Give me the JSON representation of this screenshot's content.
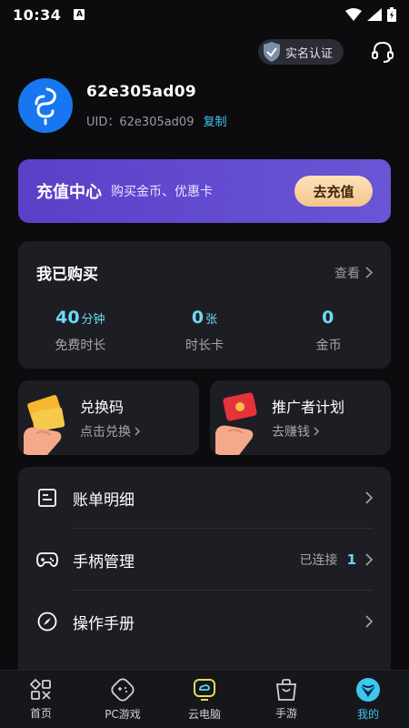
{
  "status_bar": {
    "time": "10:34",
    "notif_letter": "A"
  },
  "top": {
    "realname_label": "实名认证"
  },
  "profile": {
    "username": "62e305ad09",
    "uid_label": "UID：62e305ad09",
    "copy_label": "复制"
  },
  "recharge": {
    "title": "充值中心",
    "subtitle": "购买金币、优惠卡",
    "button_label": "去充值"
  },
  "purchased": {
    "title": "我已购买",
    "view_label": "查看",
    "stats": [
      {
        "value": "40",
        "unit": "分钟",
        "label": "免费时长"
      },
      {
        "value": "0",
        "unit": "张",
        "label": "时长卡"
      },
      {
        "value": "0",
        "unit": "",
        "label": "金币"
      }
    ]
  },
  "cards": [
    {
      "title": "兑换码",
      "subtitle": "点击兑换",
      "icon": "coupon-hand-icon"
    },
    {
      "title": "推广者计划",
      "subtitle": "去赚钱",
      "icon": "redpacket-hand-icon"
    }
  ],
  "menu": [
    {
      "label": "账单明细",
      "right_text": "",
      "count": "",
      "icon": "bill-icon"
    },
    {
      "label": "手柄管理",
      "right_text": "已连接",
      "count": "1",
      "icon": "gamepad-icon"
    },
    {
      "label": "操作手册",
      "right_text": "",
      "count": "",
      "icon": "compass-icon"
    }
  ],
  "tabs": [
    {
      "label": "首页",
      "icon": "home-grid-icon",
      "active": false
    },
    {
      "label": "PC游戏",
      "icon": "pc-game-icon",
      "active": false
    },
    {
      "label": "云电脑",
      "icon": "cloud-pc-icon",
      "active": false
    },
    {
      "label": "手游",
      "icon": "mobile-game-icon",
      "active": false
    },
    {
      "label": "我的",
      "icon": "profile-icon",
      "active": true
    }
  ],
  "colors": {
    "accent": "#3ec6f0",
    "recharge_bg": "#5b3fc7",
    "card_bg": "#1d1e24",
    "page_bg": "#0c0c0e"
  }
}
